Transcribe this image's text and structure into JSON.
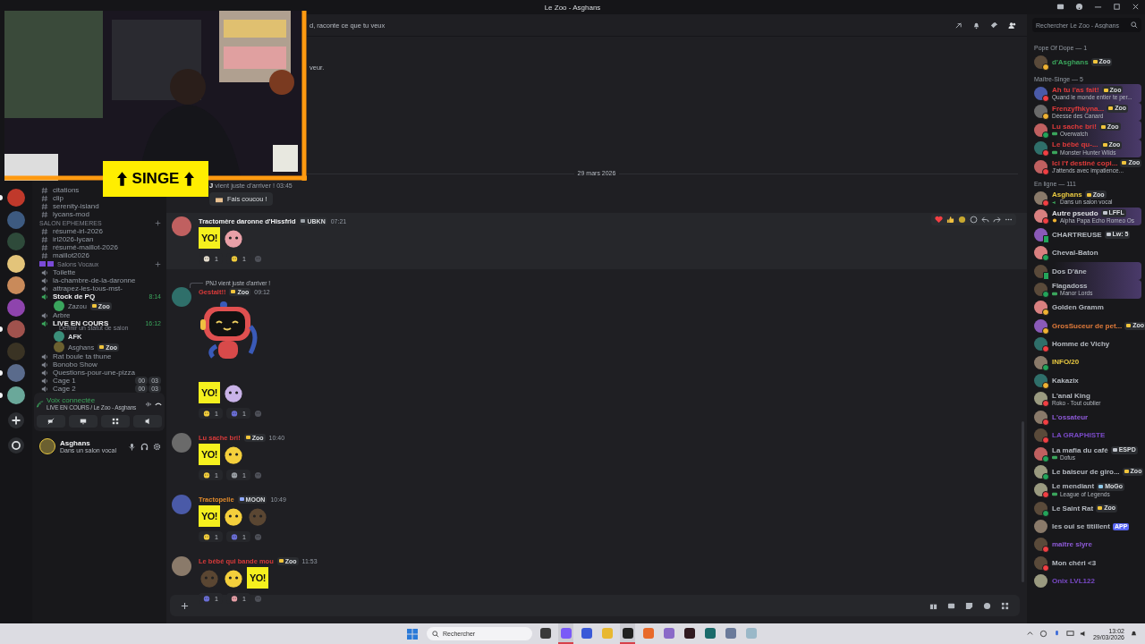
{
  "window": {
    "title": "Le Zoo - Asghans"
  },
  "overlay": {
    "banner": "SINGE"
  },
  "servers": [
    {
      "color": "#c0392b",
      "unread": true
    },
    {
      "color": "#3d5a80",
      "unread": false
    },
    {
      "color": "#2e4a3a",
      "unread": false
    },
    {
      "color": "#e3c47a",
      "unread": false
    },
    {
      "color": "#c98a5a",
      "unread": false
    },
    {
      "color": "#8e44ad",
      "unread": false
    },
    {
      "color": "#a0524d",
      "unread": true
    },
    {
      "color": "#3a3324",
      "unread": false
    },
    {
      "color": "#5a6b8c",
      "unread": true
    },
    {
      "color": "#6aa89a",
      "unread": true
    }
  ],
  "sidebar": {
    "items": [
      {
        "kind": "text",
        "name": "citations"
      },
      {
        "kind": "text",
        "name": "clip"
      },
      {
        "kind": "text",
        "name": "serenity-island"
      },
      {
        "kind": "text",
        "name": "lycans-mod"
      },
      {
        "kind": "category",
        "name": "SALON EPHEMERES",
        "decorated": false
      },
      {
        "kind": "text",
        "name": "résumé-irl-2026"
      },
      {
        "kind": "text",
        "name": "irl2026-lycan"
      },
      {
        "kind": "text",
        "name": "résumé-maillot-2026"
      },
      {
        "kind": "text",
        "name": "maillot2026"
      },
      {
        "kind": "category",
        "name": "Salons Vocaux",
        "decorated": true
      },
      {
        "kind": "voice",
        "name": "Toilette",
        "active": false
      },
      {
        "kind": "voice",
        "name": "la-chambre-de-la-daronne",
        "active": false
      },
      {
        "kind": "voice",
        "name": "attrapez-les-tous-mst-",
        "active": false
      },
      {
        "kind": "voice",
        "name": "Stock de PQ",
        "active": true,
        "time": "8:14",
        "children": [
          {
            "name": "Zazou",
            "tag": "Zoo",
            "color": "#3aa55d"
          }
        ]
      },
      {
        "kind": "voice",
        "name": "Arbre",
        "active": false
      },
      {
        "kind": "voice",
        "name": "LIVE EN COURS",
        "active": true,
        "time": "16:12",
        "status": "Définir un statut de salon",
        "children": [
          {
            "name": "AFK",
            "color": "#3b8f7a"
          },
          {
            "name": "Asghans",
            "tag": "Zoo",
            "color": "#6b6030"
          }
        ]
      },
      {
        "kind": "voice",
        "name": "Rat boule ta thune",
        "active": false
      },
      {
        "kind": "voice",
        "name": "Bonobo Show",
        "active": false
      },
      {
        "kind": "voice",
        "name": "Questions-pour-une-pizza",
        "active": false
      },
      {
        "kind": "voice",
        "name": "Cage 1",
        "active": false,
        "counts": [
          "00",
          "03"
        ]
      },
      {
        "kind": "voice",
        "name": "Cage 2",
        "active": false,
        "counts": [
          "00",
          "03"
        ]
      }
    ]
  },
  "voice_panel": {
    "title": "Voix connectée",
    "channel": "LIVE EN COURS / Le Zoo - Asghans"
  },
  "user": {
    "name": "Asghans",
    "status": "Dans un salon vocal"
  },
  "chat": {
    "topic": "d, raconte ce que tu veux",
    "fragment": "veur.",
    "date": "29 mars 2026",
    "messages": [
      {
        "kind": "join",
        "prefix": "J",
        "text": "vient juste d'arriver !",
        "time": "03:45",
        "button": "Fais coucou !"
      },
      {
        "kind": "message",
        "author": "Tractomère daronne d'Hissfrid",
        "color": "#f2f3f5",
        "tag": {
          "text": "UBKN",
          "color": "#9aa0a6"
        },
        "time": "07:21",
        "highlighted": true,
        "emojis": [
          {
            "kind": "yo",
            "text": "YO!"
          },
          {
            "kind": "pink"
          }
        ],
        "reactions": [
          {
            "kind": "cake",
            "count": "1"
          },
          {
            "kind": "yellow",
            "count": "1"
          }
        ]
      },
      {
        "kind": "message",
        "reply": "PNJ vient juste d'arriver !",
        "author": "Gestalt!!",
        "color": "#d83a3a",
        "tag": {
          "text": "Zoo",
          "color": "#f0c43c"
        },
        "time": "09:12",
        "highlighted": false,
        "sticker": {
          "kind": "robot"
        },
        "emojis": [
          {
            "kind": "yo",
            "text": "YO!"
          },
          {
            "kind": "lilac"
          }
        ],
        "reactions": [
          {
            "kind": "yellow",
            "count": "1"
          },
          {
            "kind": "blue",
            "count": "1"
          }
        ]
      },
      {
        "kind": "message",
        "author": "Lu sache bri!",
        "color": "#d83a3a",
        "tag": {
          "text": "Zoo",
          "color": "#f0c43c"
        },
        "time": "10:40",
        "highlighted": false,
        "emojis": [
          {
            "kind": "yo",
            "text": "YO!"
          },
          {
            "kind": "yellow"
          }
        ],
        "reactions": [
          {
            "kind": "yellow",
            "count": "1"
          },
          {
            "kind": "grey",
            "count": "1"
          }
        ]
      },
      {
        "kind": "message",
        "author": "Tractopelle",
        "color": "#e08a2c",
        "tag": {
          "text": "MOON",
          "color": "#8fa8ff"
        },
        "time": "10:49",
        "highlighted": false,
        "emojis": [
          {
            "kind": "yo",
            "text": "YO!"
          },
          {
            "kind": "yellow"
          },
          {
            "kind": "brown"
          }
        ],
        "reactions": [
          {
            "kind": "yellow",
            "count": "1"
          },
          {
            "kind": "blue",
            "count": "1"
          }
        ]
      },
      {
        "kind": "message",
        "author": "Le bébé qui bande mou",
        "color": "#d83a3a",
        "tag": {
          "text": "Zoo",
          "color": "#f0c43c"
        },
        "time": "11:53",
        "highlighted": false,
        "emojis": [
          {
            "kind": "brown"
          },
          {
            "kind": "yellow"
          },
          {
            "kind": "yo",
            "text": "YO!"
          }
        ],
        "reactions": [
          {
            "kind": "blue",
            "count": "1"
          },
          {
            "kind": "pink",
            "count": "1"
          }
        ]
      }
    ]
  },
  "members": {
    "search": {
      "placeholder": "Rechercher Le Zoo - Asghans"
    },
    "groups": [
      {
        "title": "Pope Of Dope — 1",
        "items": [
          {
            "name": "d'Asghans",
            "color": "#3ba55c",
            "kind": "idle",
            "tag": {
              "text": "Zoo",
              "color": "#f0c43c"
            },
            "banner": false
          }
        ]
      },
      {
        "title": "Maître-Singe — 5",
        "items": [
          {
            "name": "Ah tu l'as fait!",
            "color": "#e03b3b",
            "kind": "dnd",
            "tag": {
              "text": "Zoo",
              "color": "#f0c43c"
            },
            "activity": {
              "text": "Quand le monde entier te per..."
            },
            "banner": true
          },
          {
            "name": "Frenzyfhkyna...",
            "color": "#e03b3b",
            "kind": "idle",
            "tag": {
              "text": "Zoo",
              "color": "#f0c43c"
            },
            "activity": {
              "text": "Déesse des Canard"
            },
            "banner": true
          },
          {
            "name": "Lu sache bri!",
            "color": "#e03b3b",
            "kind": "online",
            "tag": {
              "text": "Zoo",
              "color": "#f0c43c"
            },
            "activity": {
              "kind": "game",
              "text": "Overwatch"
            },
            "banner": true
          },
          {
            "name": "Le bébé qu-...",
            "color": "#e03b3b",
            "kind": "dnd",
            "tag": {
              "text": "Zoo",
              "color": "#f0c43c"
            },
            "activity": {
              "kind": "game",
              "text": "Monster Hunter Wilds"
            },
            "banner": true
          },
          {
            "name": "Ici l'f destiné copi...",
            "color": "#e03b3b",
            "kind": "dnd",
            "tag": {
              "text": "Zoo",
              "color": "#f0c43c"
            },
            "activity": {
              "text": "J'attends avec impatience..."
            },
            "banner": false
          }
        ]
      },
      {
        "title": "En ligne — 111",
        "items": [
          {
            "name": "Asghans",
            "color": "#e8c840",
            "kind": "dnd",
            "tag": {
              "text": "Zoo",
              "color": "#f0c43c"
            },
            "activity": {
              "kind": "voice",
              "text": "Dans un salon vocal"
            },
            "banner": false
          },
          {
            "name": "Autre pseudo",
            "color": "#dfe1e5",
            "kind": "dnd",
            "tag": {
              "text": "LFFL",
              "color": "#c0c4cc"
            },
            "activity": {
              "kind": "custom",
              "text": "Alpha Papa Echo Romeo Os"
            },
            "banner": true
          },
          {
            "name": "CHARTREUSE",
            "color": "#b5bac1",
            "kind": "mobile",
            "tag": {
              "text": "Lw: 5",
              "color": "#c0c4cc"
            },
            "banner": false
          },
          {
            "name": "Cheval-Baton",
            "color": "#b5bac1",
            "kind": "online",
            "banner": false
          },
          {
            "name": "Dos D'âne",
            "color": "#b5bac1",
            "kind": "mobile",
            "banner": true
          },
          {
            "name": "Flagadoss",
            "color": "#b5bac1",
            "kind": "online",
            "activity": {
              "kind": "game",
              "text": "Manor Lords"
            },
            "banner": true
          },
          {
            "name": "Golden Gramm",
            "color": "#b5bac1",
            "kind": "idle",
            "banner": false
          },
          {
            "name": "GrosSuceur de pet...",
            "color": "#e07a3a",
            "kind": "idle",
            "tag": {
              "text": "Zoo",
              "color": "#f0c43c"
            },
            "banner": false
          },
          {
            "name": "Homme de Vichy",
            "color": "#b5bac1",
            "kind": "dnd",
            "banner": false
          },
          {
            "name": "INFO/20",
            "color": "#e8c840",
            "kind": "online",
            "banner": false
          },
          {
            "name": "Kakazix",
            "color": "#b5bac1",
            "kind": "idle",
            "banner": false
          },
          {
            "name": "L'anal King",
            "color": "#b5bac1",
            "kind": "dnd",
            "activity": {
              "text": "Roko - Tout oublier"
            },
            "banner": false
          },
          {
            "name": "L'ossateur",
            "color": "#8e5ad8",
            "kind": "dnd",
            "banner": false
          },
          {
            "name": "LA GRAPHISTE",
            "color": "#7a4ac8",
            "kind": "dnd",
            "banner": false
          },
          {
            "name": "La mafia du café",
            "color": "#b5bac1",
            "kind": "online",
            "tag": {
              "text": "ESPD",
              "color": "#c0c4cc"
            },
            "activity": {
              "kind": "game",
              "text": "Dofus"
            },
            "banner": false
          },
          {
            "name": "Le baiseur de giro...",
            "color": "#b5bac1",
            "kind": "online",
            "tag": {
              "text": "Zoo",
              "color": "#f0c43c"
            },
            "banner": false
          },
          {
            "name": "Le mendiant",
            "color": "#b5bac1",
            "kind": "dnd",
            "tag": {
              "text": "MoGo",
              "color": "#8fc8e8"
            },
            "activity": {
              "kind": "game",
              "text": "League of Legends"
            },
            "banner": false
          },
          {
            "name": "Le Saint Rat",
            "color": "#b5bac1",
            "kind": "online",
            "tag": {
              "text": "Zoo",
              "color": "#f0c43c"
            },
            "banner": false
          },
          {
            "name": "les oui se titillent",
            "color": "#b5bac1",
            "app": "APP",
            "banner": false
          },
          {
            "name": "maître slyre",
            "color": "#8e5ad8",
            "kind": "dnd",
            "banner": false
          },
          {
            "name": "Mon chéri <3",
            "color": "#b5bac1",
            "kind": "dnd",
            "banner": false
          },
          {
            "name": "Onix LVL122",
            "color": "#7a4ac8",
            "banner": false
          }
        ]
      }
    ]
  },
  "taskbar": {
    "search": {
      "placeholder": "Rechercher"
    },
    "time": "13:02",
    "date": "29/03/2026",
    "apps": [
      {
        "color": "#3a3a3a",
        "running": false
      },
      {
        "color": "#7a5af8",
        "running": true
      },
      {
        "color": "#3a5ad8",
        "running": false
      },
      {
        "color": "#e8b830",
        "running": false
      },
      {
        "color": "#202020",
        "running": true
      },
      {
        "color": "#e86a2a",
        "running": false
      },
      {
        "color": "#8a6ac8",
        "running": false
      },
      {
        "color": "#301a20",
        "running": false
      },
      {
        "color": "#1a6a6a",
        "running": false
      },
      {
        "color": "#6a7a9a",
        "running": false
      },
      {
        "color": "#9ab8c8",
        "running": false
      }
    ]
  }
}
